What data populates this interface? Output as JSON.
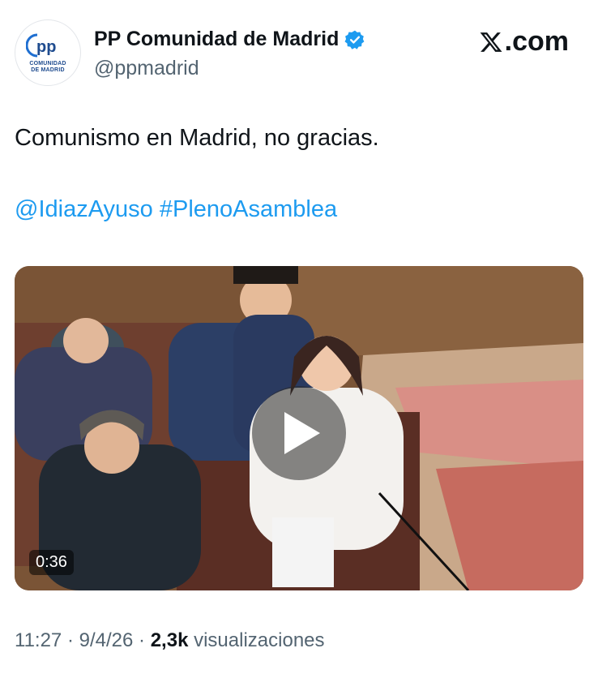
{
  "author": {
    "display_name": "PP Comunidad de Madrid",
    "handle": "@ppmadrid",
    "avatar_mark": "pp",
    "avatar_caption_line1": "COMUNIDAD",
    "avatar_caption_line2": "DE MADRID",
    "verified": true,
    "verified_icon": "verified-badge-icon"
  },
  "brand": {
    "logo_text": ".com",
    "logo_icon": "x-logo-icon"
  },
  "tweet": {
    "text": "Comunismo en Madrid, no gracias.",
    "mention": "@IdiazAyuso",
    "hashtag": "#PlenoAsamblea"
  },
  "media": {
    "type": "video",
    "duration": "0:36",
    "play_icon": "play-icon"
  },
  "meta": {
    "time": "11:27",
    "separator": "·",
    "date": "9/4/26",
    "views_count": "2,3k",
    "views_label": "visualizaciones"
  },
  "colors": {
    "accent": "#1d9bf0",
    "text": "#0f1419",
    "muted": "#536471"
  }
}
